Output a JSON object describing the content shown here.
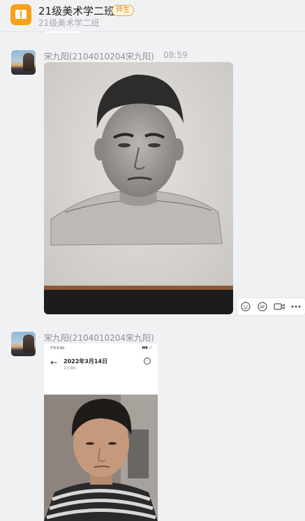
{
  "header": {
    "group_title": "21级美术学二班",
    "badge": "师生",
    "subtitle": "21级美术学二班"
  },
  "messages": [
    {
      "sender": "宋九阳(2104010204宋九阳)",
      "time": "08:59",
      "content": "sketch-portrait-photo"
    },
    {
      "sender": "宋九阳(2104010204宋九阳)",
      "content": "phone-screenshot-photo"
    }
  ],
  "actions": [
    "add-emoji-icon",
    "comment-icon",
    "video-icon",
    "more-icon"
  ],
  "phone_screenshot": {
    "status_time": "下午3:00",
    "date": "2022年3月14日",
    "time": "17:40"
  },
  "colors": {
    "background": "#f0f1f3",
    "group_icon": "#f9a01b",
    "badge_border": "#e8a33a",
    "sender_text": "#8b8f96"
  }
}
